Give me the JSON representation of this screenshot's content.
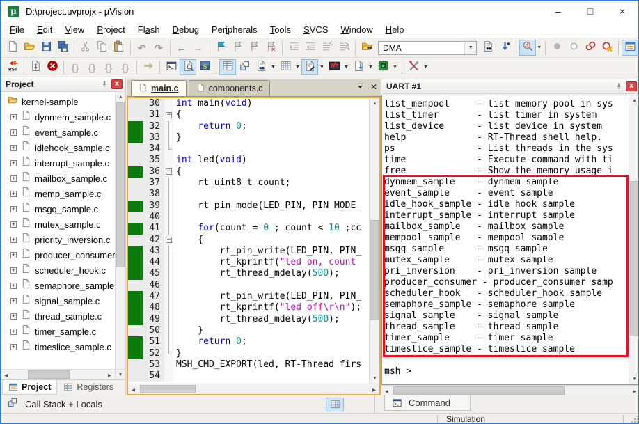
{
  "window": {
    "title": "D:\\project.uvprojx - µVision",
    "controls": {
      "minimize": "–",
      "maximize": "□",
      "close": "×"
    }
  },
  "menu": {
    "items": [
      {
        "label": "File",
        "accel": 0
      },
      {
        "label": "Edit",
        "accel": 0
      },
      {
        "label": "View",
        "accel": 0
      },
      {
        "label": "Project",
        "accel": 0
      },
      {
        "label": "Flash",
        "accel": 2
      },
      {
        "label": "Debug",
        "accel": 0
      },
      {
        "label": "Peripherals",
        "accel": 3
      },
      {
        "label": "Tools",
        "accel": 0
      },
      {
        "label": "SVCS",
        "accel": 0
      },
      {
        "label": "Window",
        "accel": 0
      },
      {
        "label": "Help",
        "accel": 0
      }
    ]
  },
  "toolbar_file": {
    "combobox_value": "DMA",
    "groups": [
      [
        {
          "n": "new-file"
        },
        {
          "n": "open-folder"
        },
        {
          "n": "save"
        },
        {
          "n": "save-all"
        }
      ],
      [
        {
          "n": "cut"
        },
        {
          "n": "copy"
        },
        {
          "n": "paste"
        }
      ],
      [
        {
          "n": "undo",
          "d": 1
        },
        {
          "n": "redo",
          "d": 1
        }
      ],
      [
        {
          "n": "back-arrow"
        },
        {
          "n": "forward-arrow",
          "d": 1
        }
      ],
      [
        {
          "n": "bookmark"
        },
        {
          "n": "bookmark-prev",
          "d": 1
        },
        {
          "n": "bookmark-next",
          "d": 1
        },
        {
          "n": "bookmark-clear",
          "d": 1
        }
      ],
      [
        {
          "n": "indent",
          "d": 1
        },
        {
          "n": "outdent",
          "d": 1
        },
        {
          "n": "comment",
          "d": 1
        },
        {
          "n": "uncomment",
          "d": 1
        }
      ],
      [
        {
          "n": "find-folder"
        },
        {
          "combo": 1
        },
        {
          "n": "find-in-files"
        },
        {
          "n": "incremental-find"
        }
      ],
      [
        {
          "n": "debug-session",
          "hl": 1,
          "dd": 1
        }
      ],
      [
        {
          "n": "breakpoint",
          "d": 1
        },
        {
          "n": "breakpoint-enable",
          "d": 1
        },
        {
          "n": "breakpoint-disable-all"
        },
        {
          "n": "breakpoint-kill-all"
        }
      ],
      [
        {
          "n": "project-window",
          "hl": 1
        }
      ]
    ]
  },
  "toolbar_debug": {
    "groups": [
      [
        {
          "n": "reset-cpu"
        }
      ],
      [
        {
          "n": "run"
        },
        {
          "n": "stop"
        }
      ],
      [
        {
          "n": "step-into",
          "d": 1
        },
        {
          "n": "step-over",
          "d": 1
        },
        {
          "n": "step-out",
          "d": 1
        },
        {
          "n": "run-to-line",
          "d": 1
        }
      ],
      [
        {
          "n": "show-current-statement"
        }
      ],
      [
        {
          "n": "command-window"
        },
        {
          "n": "disassembly-window",
          "hl": 1
        },
        {
          "n": "symbol-window"
        }
      ],
      [
        {
          "n": "registers-window",
          "hl": 1
        },
        {
          "n": "call-stack-window"
        },
        {
          "n": "watch-window",
          "dd": 1
        },
        {
          "n": "memory-window",
          "dd": 1
        },
        {
          "n": "serial-window",
          "hl": 1,
          "dd": 1
        },
        {
          "n": "analysis-window",
          "dd": 1
        },
        {
          "n": "trace-window",
          "dd": 1
        },
        {
          "n": "system-viewer",
          "dd": 1
        }
      ],
      [
        {
          "n": "toolbox",
          "dd": 1
        }
      ]
    ]
  },
  "project": {
    "title": "Project",
    "root": "kernel-sample",
    "files": [
      "dynmem_sample.c",
      "event_sample.c",
      "idlehook_sample.c",
      "interrupt_sample.c",
      "mailbox_sample.c",
      "memp_sample.c",
      "msgq_sample.c",
      "mutex_sample.c",
      "priority_inversion.c",
      "producer_consumer.c",
      "scheduler_hook.c",
      "semaphore_sample.c",
      "signal_sample.c",
      "thread_sample.c",
      "timer_sample.c",
      "timeslice_sample.c"
    ]
  },
  "editor": {
    "tabs": [
      {
        "label": "main.c",
        "active": true
      },
      {
        "label": "components.c",
        "active": false
      }
    ],
    "lines": [
      {
        "n": 30,
        "seg": [
          [
            "k",
            "int"
          ],
          [
            "p",
            " main("
          ],
          [
            "k",
            "void"
          ],
          [
            "p",
            ")"
          ]
        ]
      },
      {
        "n": 31,
        "f": "s",
        "seg": [
          [
            "p",
            "{"
          ]
        ]
      },
      {
        "n": 32,
        "g": 1,
        "f": "l",
        "seg": [
          [
            "p",
            "    "
          ],
          [
            "k",
            "return"
          ],
          [
            "p",
            " "
          ],
          [
            "num",
            "0"
          ],
          [
            "p",
            ";"
          ]
        ]
      },
      {
        "n": 33,
        "g": 1,
        "f": "l",
        "seg": [
          [
            "p",
            "}"
          ]
        ]
      },
      {
        "n": 34,
        "f": "e",
        "seg": []
      },
      {
        "n": 35,
        "seg": [
          [
            "k",
            "int"
          ],
          [
            "p",
            " led("
          ],
          [
            "k",
            "void"
          ],
          [
            "p",
            ")"
          ]
        ]
      },
      {
        "n": 36,
        "g": 1,
        "f": "s",
        "seg": [
          [
            "p",
            "{"
          ]
        ]
      },
      {
        "n": 37,
        "f": "l",
        "seg": [
          [
            "p",
            "    rt_uint8_t count;"
          ]
        ]
      },
      {
        "n": 38,
        "f": "l",
        "seg": []
      },
      {
        "n": 39,
        "g": 1,
        "f": "l",
        "seg": [
          [
            "p",
            "    rt_pin_mode(LED_PIN, PIN_MODE_"
          ]
        ]
      },
      {
        "n": 40,
        "f": "l",
        "seg": []
      },
      {
        "n": 41,
        "g": 1,
        "f": "l",
        "seg": [
          [
            "p",
            "    "
          ],
          [
            "k",
            "for"
          ],
          [
            "p",
            "(count = "
          ],
          [
            "num",
            "0"
          ],
          [
            "p",
            " ; count < "
          ],
          [
            "num",
            "10"
          ],
          [
            "p",
            " ;cc"
          ]
        ]
      },
      {
        "n": 42,
        "f": "s",
        "seg": [
          [
            "p",
            "    {"
          ]
        ]
      },
      {
        "n": 43,
        "g": 1,
        "f": "l",
        "seg": [
          [
            "p",
            "        rt_pin_write(LED_PIN, PIN_"
          ]
        ]
      },
      {
        "n": 44,
        "g": 1,
        "f": "l",
        "seg": [
          [
            "p",
            "        rt_kprintf("
          ],
          [
            "s",
            "\"led on, count"
          ]
        ]
      },
      {
        "n": 45,
        "g": 1,
        "f": "l",
        "seg": [
          [
            "p",
            "        rt_thread_mdelay("
          ],
          [
            "num",
            "500"
          ],
          [
            "p",
            ");"
          ]
        ]
      },
      {
        "n": 46,
        "f": "l",
        "seg": []
      },
      {
        "n": 47,
        "g": 1,
        "f": "l",
        "seg": [
          [
            "p",
            "        rt_pin_write(LED_PIN, PIN_"
          ]
        ]
      },
      {
        "n": 48,
        "g": 1,
        "f": "l",
        "seg": [
          [
            "p",
            "        rt_kprintf("
          ],
          [
            "s",
            "\"led off\\r\\n\""
          ],
          [
            "p",
            ");"
          ]
        ]
      },
      {
        "n": 49,
        "g": 1,
        "f": "l",
        "seg": [
          [
            "p",
            "        rt_thread_mdelay("
          ],
          [
            "num",
            "500"
          ],
          [
            "p",
            ");"
          ]
        ]
      },
      {
        "n": 50,
        "f": "l",
        "seg": [
          [
            "p",
            "    }"
          ]
        ]
      },
      {
        "n": 51,
        "g": 1,
        "f": "l",
        "seg": [
          [
            "p",
            "    "
          ],
          [
            "k",
            "return"
          ],
          [
            "p",
            " "
          ],
          [
            "num",
            "0"
          ],
          [
            "p",
            ";"
          ]
        ]
      },
      {
        "n": 52,
        "g": 1,
        "f": "e",
        "seg": [
          [
            "p",
            "}"
          ]
        ]
      },
      {
        "n": 53,
        "seg": [
          [
            "p",
            "MSH_CMD_EXPORT(led, RT-Thread firs"
          ]
        ]
      },
      {
        "n": 54,
        "seg": []
      }
    ]
  },
  "uart": {
    "title": "UART #1",
    "lines": [
      "list_mempool     - list memory pool in sys",
      "list_timer       - list timer in system",
      "list_device      - list device in system",
      "help             - RT-Thread shell help.",
      "ps               - List threads in the sys",
      "time             - Execute command with ti",
      "free             - Show the memory usage i",
      "dynmem_sample    - dynmem sample",
      "event_sample     - event sample",
      "idle_hook_sample - idle hook sample",
      "interrupt_sample - interrupt sample",
      "mailbox_sample   - mailbox sample",
      "mempool_sample   - mempool sample",
      "msgq_sample      - msgq sample",
      "mutex_sample     - mutex sample",
      "pri_inversion    - pri_inversion sample",
      "producer_consumer - producer_consumer samp",
      "scheduler_hook   - scheduler_hook sample",
      "semaphore_sample - semaphore sample",
      "signal_sample    - signal sample",
      "thread_sample    - thread sample",
      "timer_sample     - timer sample",
      "timeslice_sample - timeslice sample",
      "",
      "msh >"
    ],
    "highlight_lines": {
      "start": 7,
      "end": 22
    },
    "highlight_color": "#e81123"
  },
  "bottom": {
    "project_tab": "Project",
    "registers_tab": "Registers",
    "call_stack_label": "Call Stack + Locals",
    "command_label": "Command"
  },
  "status": {
    "mode": "Simulation"
  }
}
